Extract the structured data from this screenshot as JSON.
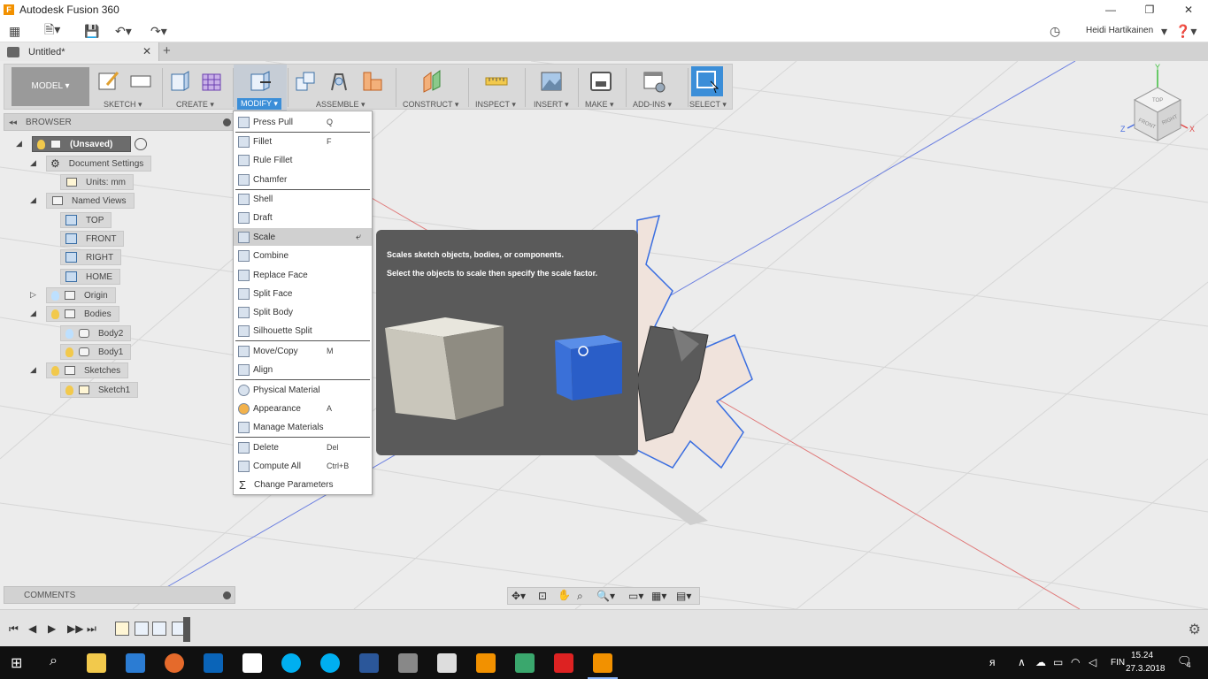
{
  "window": {
    "title": "Autodesk Fusion 360",
    "app_icon": "F"
  },
  "user": {
    "name": "Heidi Hartikainen"
  },
  "tab": {
    "label": "Untitled*"
  },
  "ribbon": {
    "workspace": "MODEL ▾",
    "groups": [
      {
        "label": "SKETCH ▾"
      },
      {
        "label": "CREATE ▾"
      },
      {
        "label": "MODIFY ▾"
      },
      {
        "label": "ASSEMBLE ▾"
      },
      {
        "label": "CONSTRUCT ▾"
      },
      {
        "label": "INSPECT ▾"
      },
      {
        "label": "INSERT ▾"
      },
      {
        "label": "MAKE ▾"
      },
      {
        "label": "ADD-INS ▾"
      },
      {
        "label": "SELECT ▾"
      }
    ]
  },
  "browser": {
    "title": "BROWSER",
    "items": [
      {
        "label": "(Unsaved)"
      },
      {
        "label": "Document Settings"
      },
      {
        "label": "Units: mm"
      },
      {
        "label": "Named Views"
      },
      {
        "label": "TOP"
      },
      {
        "label": "FRONT"
      },
      {
        "label": "RIGHT"
      },
      {
        "label": "HOME"
      },
      {
        "label": "Origin"
      },
      {
        "label": "Bodies"
      },
      {
        "label": "Body2"
      },
      {
        "label": "Body1"
      },
      {
        "label": "Sketches"
      },
      {
        "label": "Sketch1"
      }
    ]
  },
  "comments": {
    "title": "COMMENTS"
  },
  "menu": {
    "items": [
      {
        "label": "Press Pull",
        "shortcut": "Q"
      },
      {
        "label": "Fillet",
        "shortcut": "F"
      },
      {
        "label": "Rule Fillet",
        "shortcut": ""
      },
      {
        "label": "Chamfer",
        "shortcut": ""
      },
      {
        "label": "Shell",
        "shortcut": ""
      },
      {
        "label": "Draft",
        "shortcut": ""
      },
      {
        "label": "Scale",
        "shortcut": ""
      },
      {
        "label": "Combine",
        "shortcut": ""
      },
      {
        "label": "Replace Face",
        "shortcut": ""
      },
      {
        "label": "Split Face",
        "shortcut": ""
      },
      {
        "label": "Split Body",
        "shortcut": ""
      },
      {
        "label": "Silhouette Split",
        "shortcut": ""
      },
      {
        "label": "Move/Copy",
        "shortcut": "M"
      },
      {
        "label": "Align",
        "shortcut": ""
      },
      {
        "label": "Physical Material",
        "shortcut": ""
      },
      {
        "label": "Appearance",
        "shortcut": "A"
      },
      {
        "label": "Manage Materials",
        "shortcut": ""
      },
      {
        "label": "Delete",
        "shortcut": "Del"
      },
      {
        "label": "Compute All",
        "shortcut": "Ctrl+B"
      },
      {
        "label": "Change Parameters",
        "shortcut": ""
      }
    ]
  },
  "tooltip": {
    "line1": "Scales sketch objects, bodies, or components.",
    "line2": "Select the objects to scale then specify the scale factor."
  },
  "viewcube": {
    "top": "TOP",
    "front": "FRONT",
    "right": "RIGHT",
    "axis_x": "X",
    "axis_y": "Y",
    "axis_z": "Z"
  },
  "taskbar": {
    "language": "FIN",
    "time": "15.24",
    "date": "27.3.2018",
    "notifications": "4"
  },
  "colors": {
    "accent": "#3b8ed8",
    "brand": "#f29100",
    "taskbar": "#101010"
  }
}
